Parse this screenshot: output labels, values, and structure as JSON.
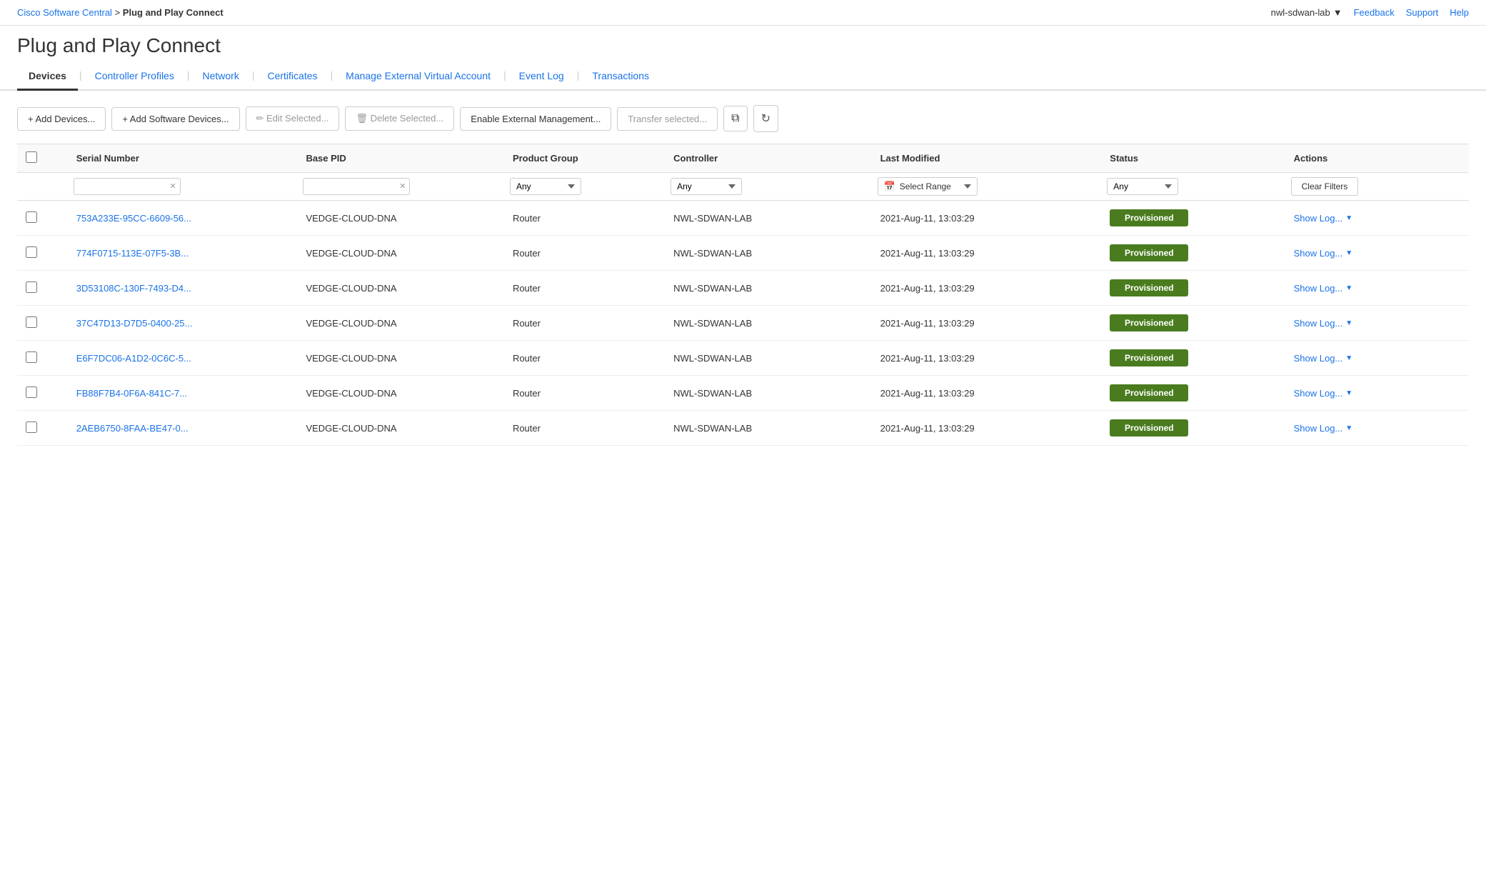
{
  "breadcrumb": {
    "parent": "Cisco Software Central",
    "separator": ">",
    "current": "Plug and Play Connect"
  },
  "page_title": "Plug and Play Connect",
  "top_right": {
    "account": "nwl-sdwan-lab",
    "links": [
      "Feedback",
      "Support",
      "Help"
    ]
  },
  "tabs": [
    {
      "id": "devices",
      "label": "Devices",
      "active": true
    },
    {
      "id": "controller-profiles",
      "label": "Controller Profiles",
      "active": false
    },
    {
      "id": "network",
      "label": "Network",
      "active": false
    },
    {
      "id": "certificates",
      "label": "Certificates",
      "active": false
    },
    {
      "id": "manage-external",
      "label": "Manage External Virtual Account",
      "active": false
    },
    {
      "id": "event-log",
      "label": "Event Log",
      "active": false
    },
    {
      "id": "transactions",
      "label": "Transactions",
      "active": false
    }
  ],
  "toolbar": {
    "add_devices": "+ Add Devices...",
    "add_software_devices": "+ Add Software Devices...",
    "edit_selected": "✏ Edit Selected...",
    "delete_selected": "🗑 Delete Selected...",
    "enable_external": "Enable External Management...",
    "transfer_selected": "Transfer selected..."
  },
  "table": {
    "columns": [
      "Serial Number",
      "Base PID",
      "Product Group",
      "Controller",
      "Last Modified",
      "Status",
      "Actions"
    ],
    "filters": {
      "serial_placeholder": "",
      "pid_placeholder": "",
      "product_group_options": [
        "Any"
      ],
      "controller_options": [
        "Any"
      ],
      "date_label": "Select Range",
      "status_options": [
        "Any"
      ],
      "clear_label": "Clear Filters"
    },
    "rows": [
      {
        "serial": "753A233E-95CC-6609-56...",
        "pid": "VEDGE-CLOUD-DNA",
        "group": "Router",
        "controller": "NWL-SDWAN-LAB",
        "modified": "2021-Aug-11, 13:03:29",
        "status": "Provisioned",
        "action": "Show Log..."
      },
      {
        "serial": "774F0715-113E-07F5-3B...",
        "pid": "VEDGE-CLOUD-DNA",
        "group": "Router",
        "controller": "NWL-SDWAN-LAB",
        "modified": "2021-Aug-11, 13:03:29",
        "status": "Provisioned",
        "action": "Show Log..."
      },
      {
        "serial": "3D53108C-130F-7493-D4...",
        "pid": "VEDGE-CLOUD-DNA",
        "group": "Router",
        "controller": "NWL-SDWAN-LAB",
        "modified": "2021-Aug-11, 13:03:29",
        "status": "Provisioned",
        "action": "Show Log..."
      },
      {
        "serial": "37C47D13-D7D5-0400-25...",
        "pid": "VEDGE-CLOUD-DNA",
        "group": "Router",
        "controller": "NWL-SDWAN-LAB",
        "modified": "2021-Aug-11, 13:03:29",
        "status": "Provisioned",
        "action": "Show Log..."
      },
      {
        "serial": "E6F7DC06-A1D2-0C6C-5...",
        "pid": "VEDGE-CLOUD-DNA",
        "group": "Router",
        "controller": "NWL-SDWAN-LAB",
        "modified": "2021-Aug-11, 13:03:29",
        "status": "Provisioned",
        "action": "Show Log..."
      },
      {
        "serial": "FB88F7B4-0F6A-841C-7...",
        "pid": "VEDGE-CLOUD-DNA",
        "group": "Router",
        "controller": "NWL-SDWAN-LAB",
        "modified": "2021-Aug-11, 13:03:29",
        "status": "Provisioned",
        "action": "Show Log..."
      },
      {
        "serial": "2AEB6750-8FAA-BE47-0...",
        "pid": "VEDGE-CLOUD-DNA",
        "group": "Router",
        "controller": "NWL-SDWAN-LAB",
        "modified": "2021-Aug-11, 13:03:29",
        "status": "Provisioned",
        "action": "Show Log..."
      }
    ]
  }
}
